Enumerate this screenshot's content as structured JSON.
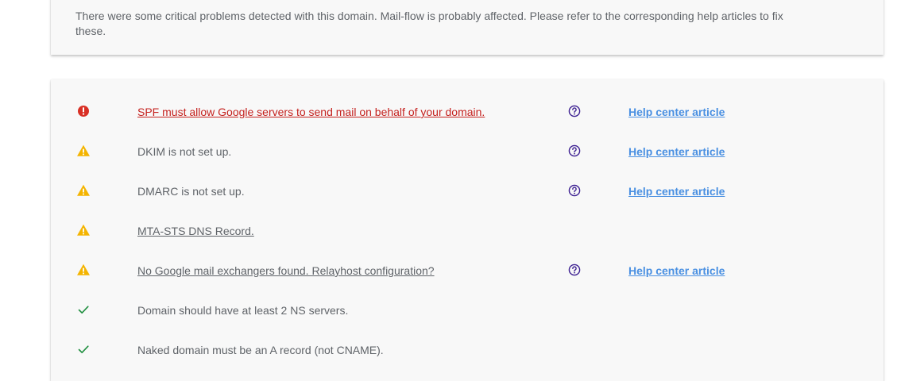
{
  "summary": {
    "text": "There were some critical problems detected with this domain. Mail-flow is probably affected. Please refer to the corresponding help articles to fix these."
  },
  "colors": {
    "error": "#d93025",
    "warning": "#f4b400",
    "ok": "#1e8e3e",
    "help_icon": "#3c1f91",
    "link": "#4a90e2"
  },
  "checks": [
    {
      "status": "error",
      "status_icon": "error-icon",
      "message": "SPF must allow Google servers to send mail on behalf of your domain.",
      "has_help": true,
      "help_label": "Help center article"
    },
    {
      "status": "warning",
      "status_icon": "warning-icon",
      "message": "DKIM is not set up.",
      "has_help": true,
      "help_label": "Help center article"
    },
    {
      "status": "warning",
      "status_icon": "warning-icon",
      "message": "DMARC is not set up.",
      "has_help": true,
      "help_label": "Help center article"
    },
    {
      "status": "warning",
      "status_icon": "warning-icon",
      "message": "MTA-STS DNS Record.",
      "has_help": false
    },
    {
      "status": "warning",
      "status_icon": "warning-icon",
      "message": "No Google mail exchangers found. Relayhost configuration?",
      "has_help": true,
      "help_label": "Help center article"
    },
    {
      "status": "ok",
      "status_icon": "check-icon",
      "message": "Domain should have at least 2 NS servers.",
      "has_help": false
    },
    {
      "status": "ok",
      "status_icon": "check-icon",
      "message": "Naked domain must be an A record (not CNAME).",
      "has_help": false
    }
  ]
}
